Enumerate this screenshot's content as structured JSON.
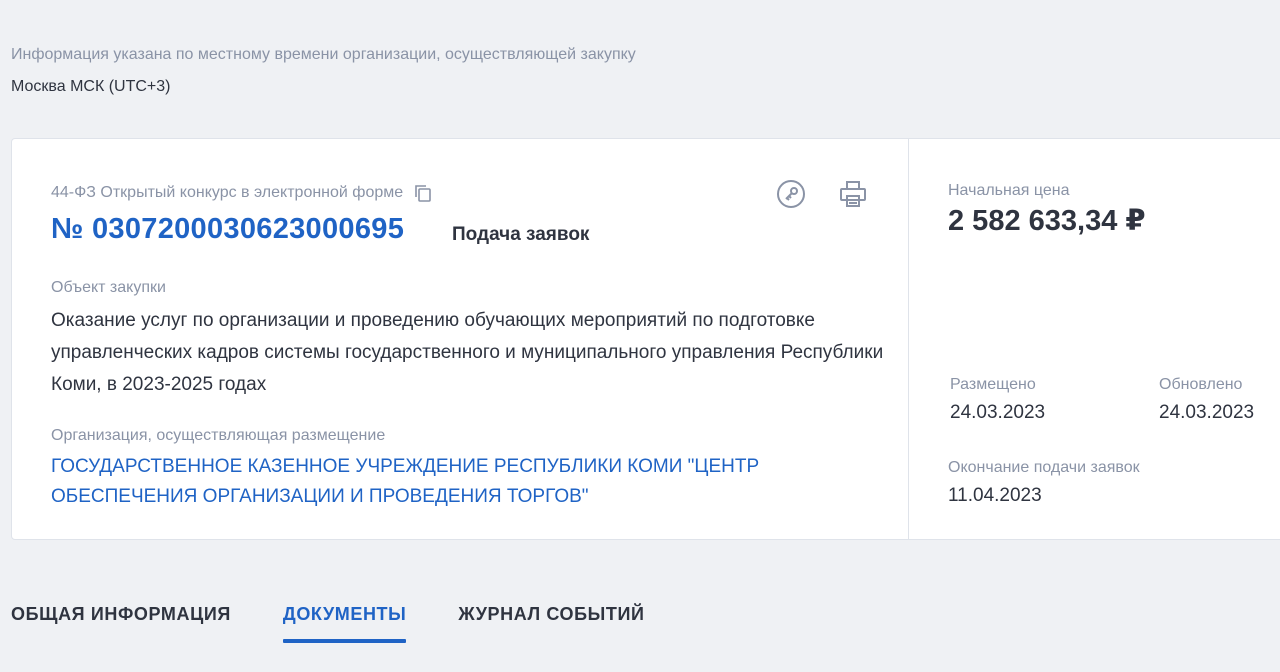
{
  "timezone": {
    "note": "Информация указана по местному времени организации, осуществляющей закупку",
    "value": "Москва МСК (UTC+3)"
  },
  "procurement": {
    "type": "44-ФЗ Открытый конкурс в электронной форме",
    "number": "№ 0307200030623000695",
    "status": "Подача заявок",
    "object_label": "Объект закупки",
    "object_text": "Оказание услуг по организации и проведению обучающих мероприятий по подготовке управленческих кадров системы государственного и муниципального управления Республики Коми, в 2023-2025 годах",
    "org_label": "Организация, осуществляющая размещение",
    "org_name": "ГОСУДАРСТВЕННОЕ КАЗЕННОЕ УЧРЕЖДЕНИЕ РЕСПУБЛИКИ КОМИ \"ЦЕНТР ОБЕСПЕЧЕНИЯ ОРГАНИЗАЦИИ И ПРОВЕДЕНИЯ ТОРГОВ\""
  },
  "summary": {
    "price_label": "Начальная цена",
    "price_value": "2 582 633,34 ₽",
    "posted_label": "Размещено",
    "posted_value": "24.03.2023",
    "updated_label": "Обновлено",
    "updated_value": "24.03.2023",
    "deadline_label": "Окончание подачи заявок",
    "deadline_value": "11.04.2023"
  },
  "icons": {
    "copy": "copy-icon",
    "key": "key-icon",
    "print": "printer-icon"
  },
  "tabs": [
    {
      "label": "ОБЩАЯ ИНФОРМАЦИЯ",
      "active": false
    },
    {
      "label": "ДОКУМЕНТЫ",
      "active": true
    },
    {
      "label": "ЖУРНАЛ СОБЫТИЙ",
      "active": false
    }
  ],
  "colors": {
    "accent": "#1f63c5",
    "muted": "#8a93a6",
    "text": "#2f3440",
    "background": "#eff1f4"
  }
}
